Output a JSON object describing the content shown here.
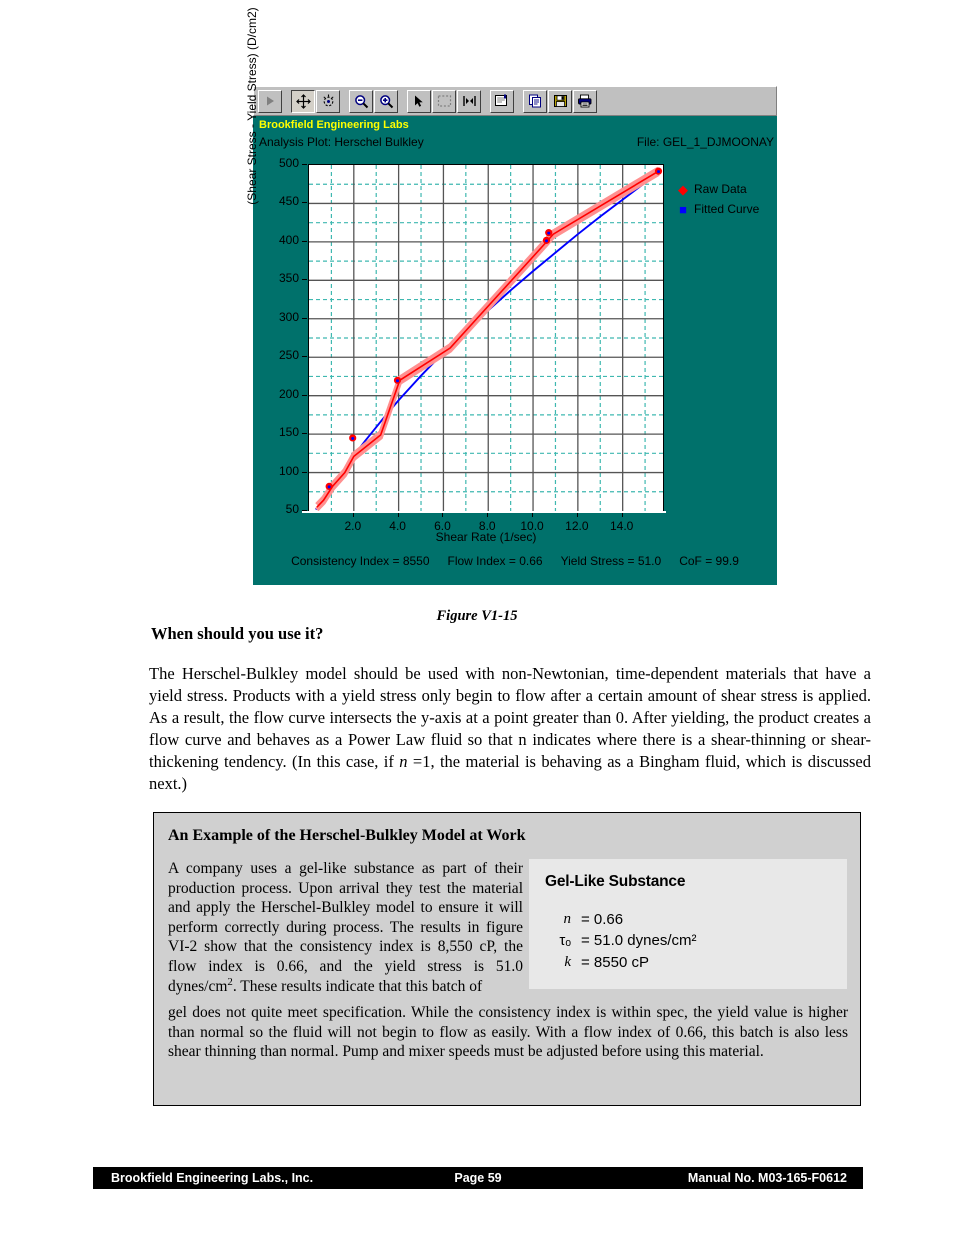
{
  "plot_window": {
    "toolbar": {
      "buttons": [
        {
          "name": "play-button",
          "icon": "play-triangle-icon"
        },
        {
          "name": "pan-button",
          "icon": "move-crosshair-icon",
          "pressed": true
        },
        {
          "name": "rotate-button",
          "icon": "rotate-point-icon"
        },
        {
          "name": "zoom-out-button",
          "icon": "magnifier-minus-icon"
        },
        {
          "name": "zoom-in-button",
          "icon": "magnifier-plus-icon"
        },
        {
          "name": "pointer-button",
          "icon": "arrow-cursor-icon"
        },
        {
          "name": "marquee-select-button",
          "icon": "dashed-rectangle-icon"
        },
        {
          "name": "fit-width-button",
          "icon": "fit-horizontal-icon"
        },
        {
          "name": "properties-button",
          "icon": "properties-window-icon"
        },
        {
          "name": "copy-button",
          "icon": "copy-pages-icon"
        },
        {
          "name": "save-button",
          "icon": "floppy-disk-icon"
        },
        {
          "name": "print-button",
          "icon": "printer-icon"
        }
      ]
    },
    "title": "Brookfield Engineering Labs",
    "subtitle": "Analysis Plot: Herschel Bulkley",
    "file_label": "File: GEL_1_DJMOONAY",
    "stats": [
      "Consistency Index = 8550",
      "Flow Index = 0.66",
      "Yield Stress = 51.0",
      "CoF = 99.9"
    ],
    "colors": {
      "background": "#00716b",
      "title": "#ffff00",
      "raw_data": "#ff0000",
      "fitted_curve": "#0000ff",
      "grid_major": "#555555",
      "grid_minor": "#3fb8b0"
    }
  },
  "chart_data": {
    "type": "line",
    "title": "Analysis Plot: Herschel Bulkley",
    "xlabel": "Shear Rate (1/sec)",
    "ylabel": "(Shear Stress - Yield Stress) (D/cm2)",
    "xlim": [
      0.0,
      15.8
    ],
    "ylim": [
      50,
      500
    ],
    "xticks": [
      "2.0",
      "4.0",
      "6.0",
      "8.0",
      "10.0",
      "12.0",
      "14.0"
    ],
    "xtick_values": [
      2.0,
      4.0,
      6.0,
      8.0,
      10.0,
      12.0,
      14.0
    ],
    "yticks": [
      "50",
      "100",
      "150",
      "200",
      "250",
      "300",
      "350",
      "400",
      "450",
      "500"
    ],
    "ytick_values": [
      50,
      100,
      150,
      200,
      250,
      300,
      350,
      400,
      450,
      500
    ],
    "grid": "major solid + minor dashed",
    "legend_position": "right",
    "legend": [
      {
        "label": "Raw Data",
        "marker": "diamond",
        "color": "#ff0000"
      },
      {
        "label": "Fitted Curve",
        "marker": "square",
        "color": "#0000ff"
      }
    ],
    "series": [
      {
        "name": "Fitted Curve",
        "color": "#0000ff",
        "x": [
          0.3,
          0.6,
          1.0,
          1.5,
          2.0,
          2.5,
          3.0,
          3.5,
          4.0,
          5.0,
          6.0,
          7.0,
          8.0,
          9.0,
          10.0,
          11.0,
          12.0,
          13.0,
          14.0,
          15.0,
          15.6
        ],
        "y": [
          52,
          62,
          79,
          101,
          122,
          141,
          159,
          177,
          194,
          226,
          256,
          284,
          311,
          337,
          362,
          386,
          410,
          433,
          455,
          477,
          490
        ]
      },
      {
        "name": "Raw Data",
        "color": "#ff0000",
        "x": [
          0.35,
          0.65,
          1.05,
          1.6,
          2.0,
          3.2,
          4.05,
          6.3,
          10.6,
          10.9,
          15.6
        ],
        "y": [
          55,
          64,
          82,
          100,
          121,
          149,
          220,
          262,
          400,
          410,
          492
        ]
      }
    ],
    "markers": [
      {
        "x": 0.9,
        "y": 82
      },
      {
        "x": 1.95,
        "y": 145
      },
      {
        "x": 3.95,
        "y": 220
      },
      {
        "x": 10.6,
        "y": 402
      },
      {
        "x": 10.7,
        "y": 412
      },
      {
        "x": 15.6,
        "y": 492
      }
    ]
  },
  "document": {
    "figure_caption": "Figure V1-15",
    "section_heading": "When should you use it?",
    "body_paragraph_part1": "The Herschel-Bulkley model should be used with non-Newtonian, time-dependent materials that have a yield stress.  Products with a yield stress only begin to flow after a certain amount of shear stress is applied.  As a result, the flow curve intersects the y-axis at a point greater than 0.  After yielding, the product creates a flow curve and behaves as a Power Law fluid so that n indicates where there is a shear-thinning or shear-thickening tendency.  (In this case, if ",
    "body_paragraph_italic": "n",
    "body_paragraph_part2": " =1, the material is behaving as a Bingham fluid, which is discussed next.)",
    "example_box": {
      "title": "An Example of the Herschel-Bulkley Model at Work",
      "left_text": "A company uses a gel-like substance as part of their production process. Upon arrival they test the material and apply the Herschel-Bulkley model to ensure it will perform correctly during process.  The results in figure VI-2 show that the consistency index is 8,550 cP, the flow index is 0.66, and the yield stress is 51.0 dynes/",
      "left_text_cm": "cm",
      "left_text_sup": "2",
      "left_text_after": ".  These results indicate that this batch of",
      "tail_text": "gel does not quite meet specification.  While the consistency index is within spec, the yield value is higher than normal so the fluid will not begin to flow as easily.  With a flow index of 0.66, this batch is also less shear thinning than normal.  Pump and mixer speeds must be adjusted before using this material.",
      "param_card": {
        "title": "Gel-Like Substance",
        "rows": [
          {
            "symbol": "n",
            "value": "= 0.66"
          },
          {
            "symbol": "τₒ",
            "value": "= 51.0 dynes/cm²"
          },
          {
            "symbol": "k",
            "value": "= 8550 cP"
          }
        ]
      }
    }
  },
  "footer": {
    "left": "Brookfield Engineering Labs., Inc.",
    "center": "Page  59",
    "right": "Manual No. M03-165-F0612"
  }
}
